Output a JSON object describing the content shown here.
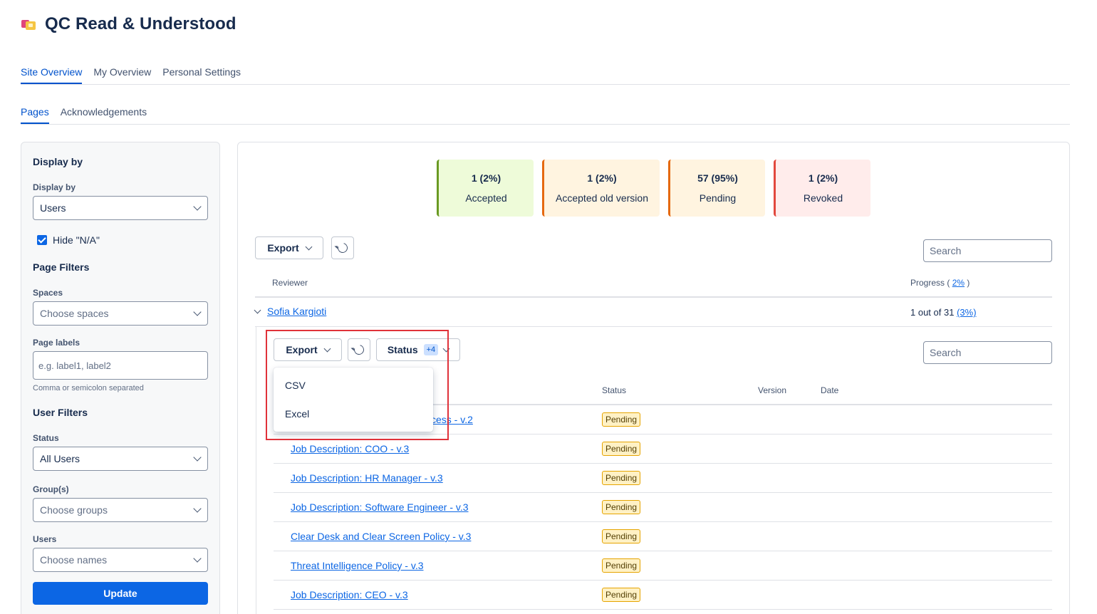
{
  "app": {
    "title": "QC Read & Understood"
  },
  "top_tabs": [
    "Site Overview",
    "My Overview",
    "Personal Settings"
  ],
  "sub_tabs": [
    "Pages",
    "Acknowledgements"
  ],
  "sidebar": {
    "display_by_heading": "Display by",
    "display_by_label": "Display by",
    "display_by_value": "Users",
    "hide_na_label": "Hide \"N/A\"",
    "page_filters_heading": "Page Filters",
    "spaces_label": "Spaces",
    "spaces_placeholder": "Choose spaces",
    "page_labels_label": "Page labels",
    "page_labels_placeholder": "e.g. label1, label2",
    "page_labels_hint": "Comma or semicolon separated",
    "user_filters_heading": "User Filters",
    "status_label": "Status",
    "status_value": "All Users",
    "groups_label": "Group(s)",
    "groups_placeholder": "Choose groups",
    "users_label": "Users",
    "users_placeholder": "Choose names",
    "update_button": "Update"
  },
  "stats": {
    "accepted": {
      "value": "1 (2%)",
      "label": "Accepted"
    },
    "old_version": {
      "value": "1 (2%)",
      "label": "Accepted old version"
    },
    "pending": {
      "value": "57 (95%)",
      "label": "Pending"
    },
    "revoked": {
      "value": "1 (2%)",
      "label": "Revoked"
    }
  },
  "toolbar": {
    "export_label": "Export",
    "search_placeholder": "Search"
  },
  "table": {
    "reviewer_header": "Reviewer",
    "progress_header": "Progress (",
    "progress_link": "2%",
    "progress_close": ")"
  },
  "reviewer": {
    "name": "Sofia Kargioti",
    "progress_text": "1 out of 31",
    "progress_link": "(3%)"
  },
  "nested": {
    "export_label": "Export",
    "status_label": "Status",
    "status_badge": "+4",
    "search_placeholder": "Search",
    "headers": {
      "status": "Status",
      "version": "Version",
      "date": "Date"
    }
  },
  "export_menu": [
    "CSV",
    "Excel"
  ],
  "pages": [
    {
      "title": "cess - v.2",
      "status": "Pending"
    },
    {
      "title": "Job Description: COO - v.3",
      "status": "Pending"
    },
    {
      "title": "Job Description: HR Manager - v.3",
      "status": "Pending"
    },
    {
      "title": "Job Description: Software Engineer - v.3",
      "status": "Pending"
    },
    {
      "title": "Clear Desk and Clear Screen Policy - v.3",
      "status": "Pending"
    },
    {
      "title": "Threat Intelligence Policy - v.3",
      "status": "Pending"
    },
    {
      "title": "Job Description: CEO - v.3",
      "status": "Pending"
    }
  ],
  "colors": {
    "link": "#0c66e4",
    "accepted_border": "#6a9a23",
    "pending_border": "#e56910",
    "revoked_border": "#e2483d",
    "highlight": "#e0323a"
  }
}
